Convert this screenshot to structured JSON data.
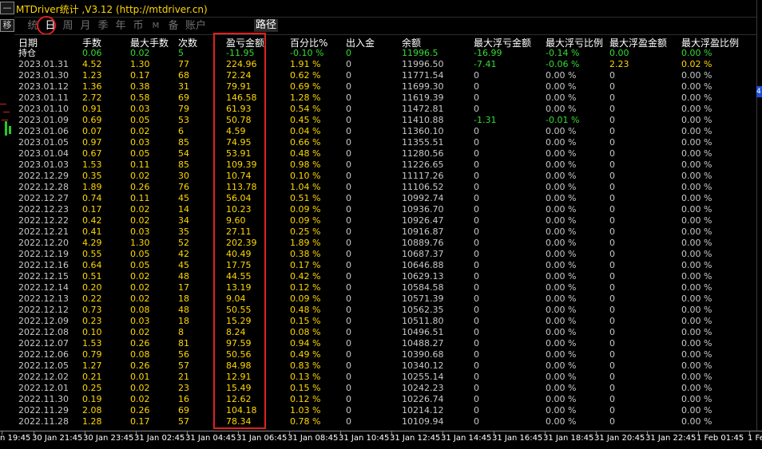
{
  "window": {
    "title": "MTDriver统计 ,V3.12 (http://mtdriver.cn)"
  },
  "left_panel": {
    "btn_top": "—",
    "btn_move": "移"
  },
  "right_panel": {
    "marker": "4"
  },
  "tabs": [
    {
      "label": "统",
      "active": false
    },
    {
      "label": "日",
      "active": true
    },
    {
      "label": "周",
      "active": false
    },
    {
      "label": "月",
      "active": false
    },
    {
      "label": "季",
      "active": false
    },
    {
      "label": "年",
      "active": false
    },
    {
      "label": "币",
      "active": false
    },
    {
      "label": "M",
      "active": false
    },
    {
      "label": "备",
      "active": false
    },
    {
      "label": "账户",
      "active": false
    }
  ],
  "path_button": "路径",
  "headers": [
    "日期",
    "手数",
    "最大手数",
    "次数",
    "盈亏金额",
    "百分比%",
    "出入金",
    "余额",
    "最大浮亏金额",
    "最大浮亏比例",
    "最大浮盈金额",
    "最大浮盈比例"
  ],
  "holding": [
    "持仓",
    "0.06",
    "0.02",
    "5",
    "-11.95",
    "-0.10 %",
    "0",
    "11996.5",
    "-16.99",
    "-0.14 %",
    "0.00",
    "0.00 %"
  ],
  "rows": [
    [
      "2023.01.31",
      "4.52",
      "1.30",
      "77",
      "224.96",
      "1.91 %",
      "0",
      "11996.50",
      "-7.41",
      "-0.06 %",
      "2.23",
      "0.02 %"
    ],
    [
      "2023.01.30",
      "1.23",
      "0.17",
      "68",
      "72.24",
      "0.62 %",
      "0",
      "11771.54",
      "0",
      "0.00 %",
      "0",
      "0.00 %"
    ],
    [
      "2023.01.12",
      "1.36",
      "0.38",
      "31",
      "79.91",
      "0.69 %",
      "0",
      "11699.30",
      "0",
      "0.00 %",
      "0",
      "0.00 %"
    ],
    [
      "2023.01.11",
      "2.72",
      "0.58",
      "69",
      "146.58",
      "1.28 %",
      "0",
      "11619.39",
      "0",
      "0.00 %",
      "0",
      "0.00 %"
    ],
    [
      "2023.01.10",
      "0.91",
      "0.03",
      "79",
      "61.93",
      "0.54 %",
      "0",
      "11472.81",
      "0",
      "0.00 %",
      "0",
      "0.00 %"
    ],
    [
      "2023.01.09",
      "0.69",
      "0.05",
      "53",
      "50.78",
      "0.45 %",
      "0",
      "11410.88",
      "-1.31",
      "-0.01 %",
      "0",
      "0.00 %"
    ],
    [
      "2023.01.06",
      "0.07",
      "0.02",
      "6",
      "4.59",
      "0.04 %",
      "0",
      "11360.10",
      "0",
      "0.00 %",
      "0",
      "0.00 %"
    ],
    [
      "2023.01.05",
      "0.97",
      "0.03",
      "85",
      "74.95",
      "0.66 %",
      "0",
      "11355.51",
      "0",
      "0.00 %",
      "0",
      "0.00 %"
    ],
    [
      "2023.01.04",
      "0.67",
      "0.05",
      "54",
      "53.91",
      "0.48 %",
      "0",
      "11280.56",
      "0",
      "0.00 %",
      "0",
      "0.00 %"
    ],
    [
      "2023.01.03",
      "1.53",
      "0.11",
      "85",
      "109.39",
      "0.98 %",
      "0",
      "11226.65",
      "0",
      "0.00 %",
      "0",
      "0.00 %"
    ],
    [
      "2022.12.29",
      "0.35",
      "0.02",
      "30",
      "10.74",
      "0.10 %",
      "0",
      "11117.26",
      "0",
      "0.00 %",
      "0",
      "0.00 %"
    ],
    [
      "2022.12.28",
      "1.89",
      "0.26",
      "76",
      "113.78",
      "1.04 %",
      "0",
      "11106.52",
      "0",
      "0.00 %",
      "0",
      "0.00 %"
    ],
    [
      "2022.12.27",
      "0.74",
      "0.11",
      "45",
      "56.04",
      "0.51 %",
      "0",
      "10992.74",
      "0",
      "0.00 %",
      "0",
      "0.00 %"
    ],
    [
      "2022.12.23",
      "0.17",
      "0.02",
      "14",
      "10.23",
      "0.09 %",
      "0",
      "10936.70",
      "0",
      "0.00 %",
      "0",
      "0.00 %"
    ],
    [
      "2022.12.22",
      "0.42",
      "0.02",
      "34",
      "9.60",
      "0.09 %",
      "0",
      "10926.47",
      "0",
      "0.00 %",
      "0",
      "0.00 %"
    ],
    [
      "2022.12.21",
      "0.41",
      "0.03",
      "35",
      "27.11",
      "0.25 %",
      "0",
      "10916.87",
      "0",
      "0.00 %",
      "0",
      "0.00 %"
    ],
    [
      "2022.12.20",
      "4.29",
      "1.30",
      "52",
      "202.39",
      "1.89 %",
      "0",
      "10889.76",
      "0",
      "0.00 %",
      "0",
      "0.00 %"
    ],
    [
      "2022.12.19",
      "0.55",
      "0.05",
      "42",
      "40.49",
      "0.38 %",
      "0",
      "10687.37",
      "0",
      "0.00 %",
      "0",
      "0.00 %"
    ],
    [
      "2022.12.16",
      "0.64",
      "0.05",
      "45",
      "17.75",
      "0.17 %",
      "0",
      "10646.88",
      "0",
      "0.00 %",
      "0",
      "0.00 %"
    ],
    [
      "2022.12.15",
      "0.51",
      "0.02",
      "48",
      "44.55",
      "0.42 %",
      "0",
      "10629.13",
      "0",
      "0.00 %",
      "0",
      "0.00 %"
    ],
    [
      "2022.12.14",
      "0.20",
      "0.02",
      "17",
      "13.19",
      "0.12 %",
      "0",
      "10584.58",
      "0",
      "0.00 %",
      "0",
      "0.00 %"
    ],
    [
      "2022.12.13",
      "0.22",
      "0.02",
      "18",
      "9.04",
      "0.09 %",
      "0",
      "10571.39",
      "0",
      "0.00 %",
      "0",
      "0.00 %"
    ],
    [
      "2022.12.12",
      "0.73",
      "0.08",
      "48",
      "50.55",
      "0.48 %",
      "0",
      "10562.35",
      "0",
      "0.00 %",
      "0",
      "0.00 %"
    ],
    [
      "2022.12.09",
      "0.23",
      "0.03",
      "18",
      "15.29",
      "0.15 %",
      "0",
      "10511.80",
      "0",
      "0.00 %",
      "0",
      "0.00 %"
    ],
    [
      "2022.12.08",
      "0.10",
      "0.02",
      "8",
      "8.24",
      "0.08 %",
      "0",
      "10496.51",
      "0",
      "0.00 %",
      "0",
      "0.00 %"
    ],
    [
      "2022.12.07",
      "1.53",
      "0.26",
      "81",
      "97.59",
      "0.94 %",
      "0",
      "10488.27",
      "0",
      "0.00 %",
      "0",
      "0.00 %"
    ],
    [
      "2022.12.06",
      "0.79",
      "0.08",
      "56",
      "50.56",
      "0.49 %",
      "0",
      "10390.68",
      "0",
      "0.00 %",
      "0",
      "0.00 %"
    ],
    [
      "2022.12.05",
      "1.27",
      "0.26",
      "57",
      "84.98",
      "0.83 %",
      "0",
      "10340.12",
      "0",
      "0.00 %",
      "0",
      "0.00 %"
    ],
    [
      "2022.12.02",
      "0.21",
      "0.01",
      "21",
      "12.91",
      "0.13 %",
      "0",
      "10255.14",
      "0",
      "0.00 %",
      "0",
      "0.00 %"
    ],
    [
      "2022.12.01",
      "0.25",
      "0.02",
      "23",
      "15.49",
      "0.15 %",
      "0",
      "10242.23",
      "0",
      "0.00 %",
      "0",
      "0.00 %"
    ],
    [
      "2022.11.30",
      "0.19",
      "0.02",
      "16",
      "12.62",
      "0.12 %",
      "0",
      "10226.74",
      "0",
      "0.00 %",
      "0",
      "0.00 %"
    ],
    [
      "2022.11.29",
      "2.08",
      "0.26",
      "69",
      "104.18",
      "1.03 %",
      "0",
      "10214.12",
      "0",
      "0.00 %",
      "0",
      "0.00 %"
    ],
    [
      "2022.11.28",
      "1.28",
      "0.17",
      "57",
      "78.34",
      "0.78 %",
      "0",
      "10109.94",
      "0",
      "0.00 %",
      "0",
      "0.00 %"
    ]
  ],
  "time_axis": [
    "n 19:45",
    "30 Jan 21:45",
    "30 Jan 23:45",
    "31 Jan 02:45",
    "31 Jan 04:45",
    "31 Jan 06:45",
    "31 Jan 08:45",
    "31 Jan 10:45",
    "31 Jan 12:45",
    "31 Jan 14:45",
    "31 Jan 16:45",
    "31 Jan 18:45",
    "31 Jan 20:45",
    "31 Jan 22:45",
    "1 Feb 01:45",
    "1 Fe"
  ],
  "colors": {
    "accent_yellow": "#ffd700",
    "negative_green": "#33dd33",
    "highlight_red": "#e11f1f",
    "background": "#000000"
  }
}
